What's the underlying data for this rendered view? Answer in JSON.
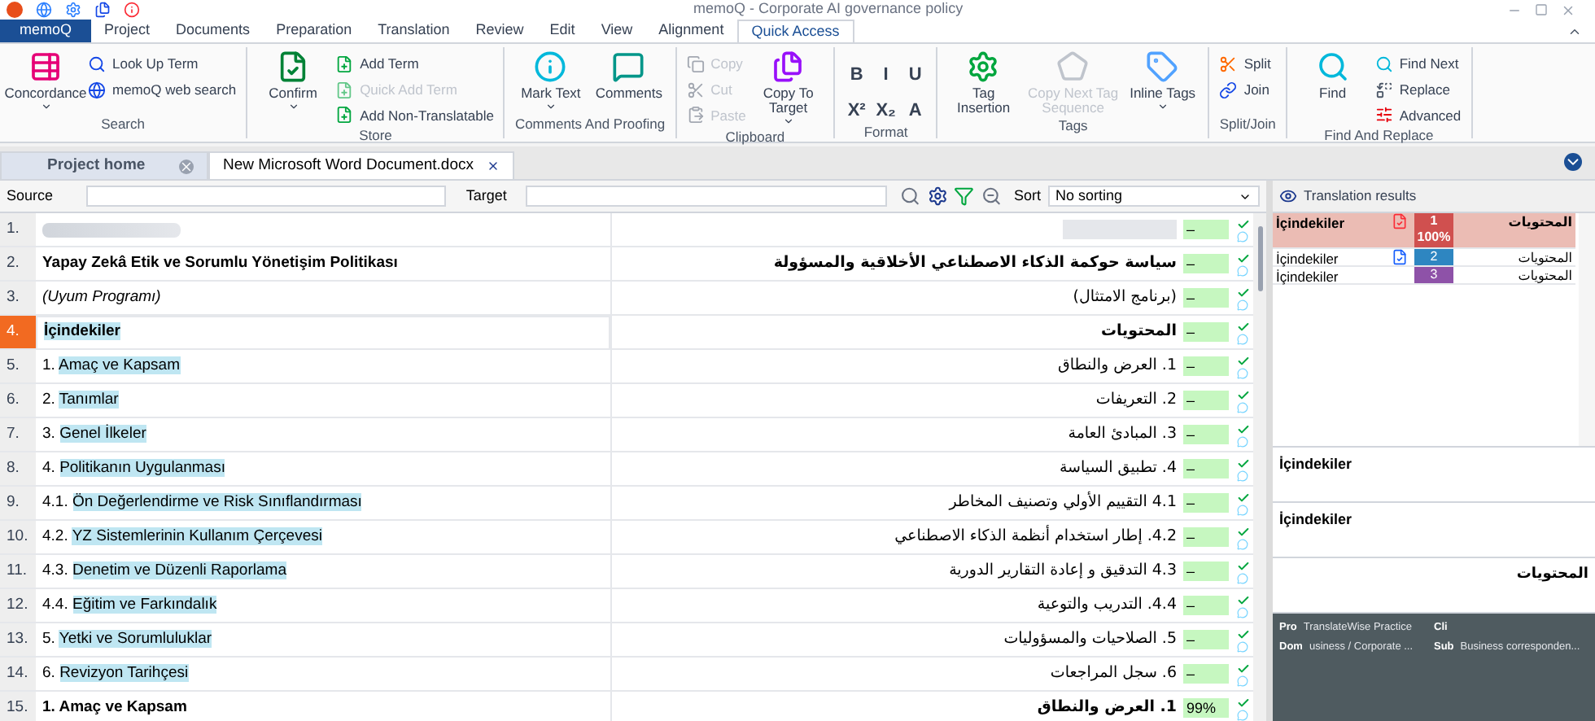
{
  "window": {
    "title": "memoQ - Corporate AI governance policy"
  },
  "app_menu": "memoQ",
  "menu_tabs": [
    {
      "label": "Project",
      "selected": false
    },
    {
      "label": "Documents",
      "selected": false
    },
    {
      "label": "Preparation",
      "selected": false
    },
    {
      "label": "Translation",
      "selected": false
    },
    {
      "label": "Review",
      "selected": false
    },
    {
      "label": "Edit",
      "selected": false
    },
    {
      "label": "View",
      "selected": false
    },
    {
      "label": "Alignment",
      "selected": false
    },
    {
      "label": "Quick Access",
      "selected": true
    }
  ],
  "ribbon": [
    {
      "title": "Search",
      "items": [
        {
          "kind": "large",
          "label": "Concordance",
          "dropdown": true,
          "disabled": false
        },
        {
          "kind": "small",
          "label": "Look Up Term",
          "disabled": false
        },
        {
          "kind": "small",
          "label": "memoQ web search",
          "disabled": false
        }
      ]
    },
    {
      "title": "Store",
      "items": [
        {
          "kind": "large",
          "label": "Confirm",
          "dropdown": true,
          "disabled": false
        },
        {
          "kind": "small",
          "label": "Add Term",
          "disabled": false
        },
        {
          "kind": "small",
          "label": "Quick Add Term",
          "disabled": true
        },
        {
          "kind": "small",
          "label": "Add Non-Translatable",
          "disabled": false
        }
      ]
    },
    {
      "title": "Comments And Proofing",
      "items": [
        {
          "kind": "large",
          "label": "Mark Text",
          "dropdown": true,
          "disabled": false
        },
        {
          "kind": "large",
          "label": "Comments",
          "dropdown": false,
          "disabled": false
        }
      ]
    },
    {
      "title": "Clipboard",
      "items": [
        {
          "kind": "small",
          "label": "Copy",
          "disabled": true
        },
        {
          "kind": "small",
          "label": "Cut",
          "disabled": true
        },
        {
          "kind": "small",
          "label": "Paste",
          "disabled": true
        },
        {
          "kind": "large",
          "label": "Copy To Target",
          "dropdown": true,
          "disabled": false
        }
      ]
    },
    {
      "title": "Format",
      "items": [
        {
          "kind": "format",
          "label": "B",
          "disabled": false
        },
        {
          "kind": "format",
          "label": "I",
          "disabled": false
        },
        {
          "kind": "format",
          "label": "U",
          "disabled": false
        },
        {
          "kind": "format",
          "label": "X²",
          "disabled": false
        },
        {
          "kind": "format",
          "label": "X₂",
          "disabled": false
        },
        {
          "kind": "format",
          "label": "A",
          "disabled": false
        }
      ]
    },
    {
      "title": "Tags",
      "items": [
        {
          "kind": "large",
          "label": "Tag Insertion",
          "dropdown": false,
          "disabled": false
        },
        {
          "kind": "large",
          "label": "Copy Next Tag Sequence",
          "dropdown": false,
          "disabled": true
        },
        {
          "kind": "large",
          "label": "Inline Tags",
          "dropdown": true,
          "disabled": false
        }
      ]
    },
    {
      "title": "Split/Join",
      "items": [
        {
          "kind": "small",
          "label": "Split",
          "disabled": false
        },
        {
          "kind": "small",
          "label": "Join",
          "disabled": false
        }
      ]
    },
    {
      "title": "Find And Replace",
      "items": [
        {
          "kind": "large",
          "label": "Find",
          "dropdown": false,
          "disabled": false
        },
        {
          "kind": "small",
          "label": "Find Next",
          "disabled": false
        },
        {
          "kind": "small",
          "label": "Replace",
          "disabled": false
        },
        {
          "kind": "small",
          "label": "Advanced",
          "disabled": false
        }
      ]
    }
  ],
  "doc_tabs": [
    {
      "label": "Project home",
      "selected": false
    },
    {
      "label": "New Microsoft Word Document.docx",
      "selected": true
    }
  ],
  "filter": {
    "source_label": "Source",
    "target_label": "Target",
    "sort_label": "Sort",
    "sort_value": "No sorting"
  },
  "segments": [
    {
      "number": "1.",
      "kind": "redacted",
      "match": "–",
      "confirmed": true,
      "selected": false
    },
    {
      "number": "2.",
      "kind": "heading",
      "source": "Yapay Zekâ Etik ve Sorumlu Yönetişim Politikası",
      "target": "سياسة حوكمة الذكاء الاصطناعي الأخلاقية والمسؤولة",
      "match": "–",
      "confirmed": true,
      "selected": false
    },
    {
      "number": "3.",
      "kind": "italic",
      "source": "(Uyum Programı)",
      "target": "(برنامج الامتثال)",
      "match": "–",
      "confirmed": true,
      "selected": false
    },
    {
      "number": "4.",
      "kind": "toc_heading",
      "source": "İçindekiler",
      "target": "المحتويات",
      "match": "–",
      "confirmed": true,
      "selected": true
    },
    {
      "number": "5.",
      "kind": "toc",
      "prefix": "1.",
      "source": "Amaç ve Kapsam",
      "target": "1. العرض والنطاق",
      "match": "–",
      "confirmed": true,
      "selected": false
    },
    {
      "number": "6.",
      "kind": "toc",
      "prefix": "2.",
      "source": "Tanımlar",
      "target": "2. التعريفات",
      "match": "–",
      "confirmed": true,
      "selected": false
    },
    {
      "number": "7.",
      "kind": "toc",
      "prefix": "3.",
      "source": "Genel İlkeler",
      "target": "3. المبادئ العامة",
      "match": "–",
      "confirmed": true,
      "selected": false
    },
    {
      "number": "8.",
      "kind": "toc",
      "prefix": "4.",
      "source": "Politikanın Uygulanması",
      "target": "4. تطبيق السياسة",
      "match": "–",
      "confirmed": true,
      "selected": false
    },
    {
      "number": "9.",
      "kind": "toc",
      "prefix": "4.1.",
      "source": "Ön Değerlendirme ve Risk Sınıflandırması",
      "target": "4.1 التقييم الأولي وتصنيف المخاطر",
      "match": "–",
      "confirmed": true,
      "selected": false
    },
    {
      "number": "10.",
      "kind": "toc",
      "prefix": "4.2.",
      "source": "YZ Sistemlerinin Kullanım Çerçevesi",
      "target": "4.2. إطار استخدام أنظمة الذكاء الاصطناعي",
      "match": "–",
      "confirmed": true,
      "selected": false
    },
    {
      "number": "11.",
      "kind": "toc",
      "prefix": "4.3.",
      "source": "Denetim ve Düzenli Raporlama",
      "target": "4.3 التدقيق و إعادة التقارير الدورية",
      "match": "–",
      "confirmed": true,
      "selected": false
    },
    {
      "number": "12.",
      "kind": "toc",
      "prefix": "4.4.",
      "source": "Eğitim ve Farkındalık",
      "target": "4.4. التدريب والتوعية",
      "match": "–",
      "confirmed": true,
      "selected": false
    },
    {
      "number": "13.",
      "kind": "toc",
      "prefix": "5.",
      "source": "Yetki ve Sorumluluklar",
      "target": "5. الصلاحيات والمسؤوليات",
      "match": "–",
      "confirmed": true,
      "selected": false
    },
    {
      "number": "14.",
      "kind": "toc",
      "prefix": "6.",
      "source": "Revizyon Tarihçesi",
      "target": "6. سجل المراجعات",
      "match": "–",
      "confirmed": true,
      "selected": false
    },
    {
      "number": "15.",
      "kind": "heading",
      "source": "1. Amaç ve Kapsam",
      "target": "1. العرض والنطاق",
      "match": "99%",
      "confirmed": true,
      "selected": false
    }
  ],
  "translation_results": {
    "title": "Translation results",
    "rows": [
      {
        "source": "İçindekiler",
        "target": "المحتويات",
        "rank": "1",
        "percent": "100%",
        "color": "#d0504f",
        "selected": true
      },
      {
        "source": "İçindekiler",
        "target": "المحتويات",
        "rank": "2",
        "color": "#2e86c1",
        "selected": false
      },
      {
        "source": "İçindekiler",
        "target": "المحتويات",
        "rank": "3",
        "color": "#8e52a8",
        "selected": false
      }
    ]
  },
  "preview": {
    "source": "İçindekiler",
    "match_source": "İçindekiler",
    "target": "المحتويات"
  },
  "info": [
    {
      "label": "Pro",
      "value": "TranslateWise Practice"
    },
    {
      "label": "Cli"
    },
    {
      "label": "Dom",
      "value": "usiness / Corporate ..."
    },
    {
      "label": "Sub",
      "value": "Business corresponden..."
    }
  ]
}
